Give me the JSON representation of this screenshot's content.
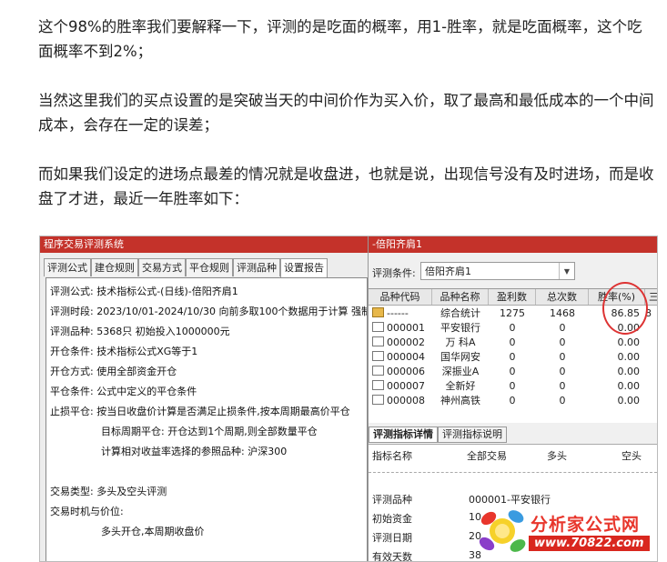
{
  "article": {
    "p1": "这个98%的胜率我们要解释一下，评测的是吃面的概率，用1-胜率，就是吃面概率，这个吃面概率不到2%；",
    "p2": "当然这里我们的买点设置的是突破当天的中间价作为买入价，取了最高和最低成本的一个中间成本，会存在一定的误差；",
    "p3": "而如果我们设定的进场点最差的情况就是收盘进，也就是说，出现信号没有及时进场，而是收盘了才进，最近一年胜率如下："
  },
  "left_window": {
    "title": "程序交易评测系统",
    "tabs": [
      "评测公式",
      "建仓规则",
      "交易方式",
      "平仓规则",
      "评测品种",
      "设置报告"
    ],
    "lines": [
      "评测公式: 技术指标公式-(日线)-倍阳齐肩1",
      "评测时段: 2023/10/01-2024/10/30 向前多取100个数据用于计算 强制",
      "评测品种: 5368只 初始投入1000000元",
      "开仓条件: 技术指标公式XG等于1",
      "开仓方式: 使用全部资金开仓",
      "平仓条件: 公式中定义的平仓条件",
      "止损平仓: 按当日收盘价计算是否满足止损条件,按本周期最高价平仓",
      "目标周期平仓: 开仓达到1个周期,则全部数量平仓",
      "计算相对收益率选择的参照品种: 沪深300",
      "交易类型: 多头及空头评测",
      "交易时机与价位:",
      "多头开仓,本周期收盘价"
    ]
  },
  "right_window": {
    "title": "-倍阳齐肩1",
    "condition_label": "评测条件:",
    "condition_value": "倍阳齐肩1",
    "columns": [
      "品种代码",
      "品种名称",
      "盈利数",
      "总次数",
      "胜率(%)"
    ],
    "rows": [
      {
        "code": "------",
        "name": "综合统计",
        "wins": "1275",
        "total": "1468",
        "rate": "86.85",
        "extra": "8"
      },
      {
        "code": "000001",
        "name": "平安银行",
        "wins": "0",
        "total": "0",
        "rate": "0.00",
        "extra": ""
      },
      {
        "code": "000002",
        "name": "万 科A",
        "wins": "0",
        "total": "0",
        "rate": "0.00",
        "extra": ""
      },
      {
        "code": "000004",
        "name": "国华网安",
        "wins": "0",
        "total": "0",
        "rate": "0.00",
        "extra": ""
      },
      {
        "code": "000006",
        "name": "深振业A",
        "wins": "0",
        "total": "0",
        "rate": "0.00",
        "extra": ""
      },
      {
        "code": "000007",
        "name": "全新好",
        "wins": "0",
        "total": "0",
        "rate": "0.00",
        "extra": ""
      },
      {
        "code": "000008",
        "name": "神州高铁",
        "wins": "0",
        "total": "0",
        "rate": "0.00",
        "extra": ""
      }
    ],
    "tabs": [
      "评测指标详情",
      "评测指标说明"
    ],
    "detail_head": [
      "指标名称",
      "全部交易",
      "多头",
      "空头"
    ],
    "detail_rows": [
      {
        "label": "评测品种",
        "value": "000001-平安银行"
      },
      {
        "label": "初始资金",
        "value": "10"
      },
      {
        "label": "评测日期",
        "value": "20"
      },
      {
        "label": "有效天数",
        "value": "38"
      }
    ]
  },
  "logo": {
    "name": "分析家公式网",
    "url": "www.70822.com"
  }
}
